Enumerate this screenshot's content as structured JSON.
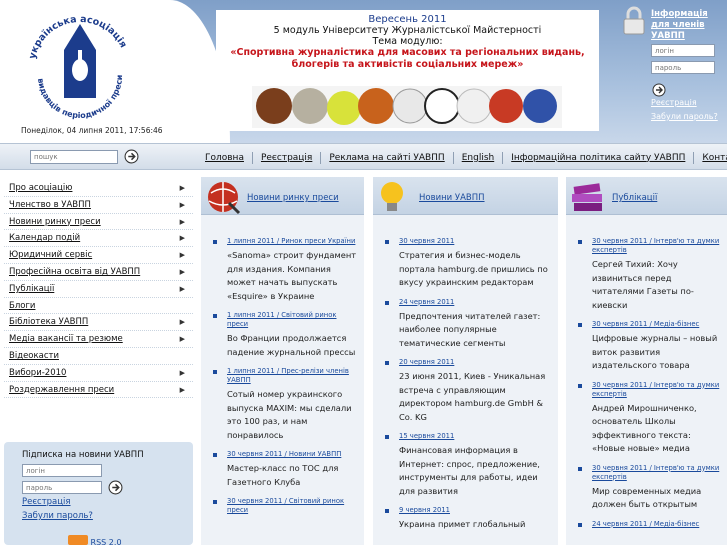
{
  "header": {
    "date": "Понеділок, 04 липня 2011, 17:56:46",
    "logo_text_top": "українська асоціація",
    "logo_text_bottom": "видавців періодичної преси",
    "banner": {
      "line1": "Вересень 2011",
      "line2": "5 модуль Університету Журналістської Майстерності",
      "line3": "Тема модулю:",
      "line4": "«Спортивна журналістика для масових та регіональних видань, блогерів та активістів соціальних мереж»"
    },
    "login": {
      "title": "Інформація для членів УАВПП",
      "login_placeholder": "логін",
      "password_placeholder": "пароль",
      "register": "Реєстрація",
      "forgot": "Забули пароль?"
    }
  },
  "navbar": {
    "search_placeholder": "пошук",
    "links": [
      "Головна",
      "Реєстрація",
      "Реклама на сайті УАВПП",
      "English",
      "Інформаційна політика сайту УАВПП",
      "Контакти"
    ]
  },
  "sidebar": {
    "menu": [
      {
        "label": "Про асоціацію",
        "arrow": true
      },
      {
        "label": "Членство в УАВПП",
        "arrow": true
      },
      {
        "label": "Новини ринку преси",
        "arrow": true
      },
      {
        "label": "Календар подій",
        "arrow": true
      },
      {
        "label": "Юридичний сервіс",
        "arrow": true
      },
      {
        "label": "Професійна освіта від УАВПП",
        "arrow": true
      },
      {
        "label": "Публікації",
        "arrow": true
      },
      {
        "label": "Блоги",
        "arrow": false
      },
      {
        "label": "Бібліотека УАВПП",
        "arrow": true
      },
      {
        "label": "Медіа вакансії та резюме",
        "arrow": true
      },
      {
        "label": "Відеокасти",
        "arrow": false
      },
      {
        "label": "Вибори-2010",
        "arrow": true
      },
      {
        "label": "Роздержавлення преси",
        "arrow": true
      }
    ],
    "subscribe": {
      "title": "Підписка на новини УАВПП",
      "login_placeholder": "логін",
      "password_placeholder": "пароль",
      "register": "Реєстрація",
      "forgot": "Забули пароль?",
      "rss": "RSS 2.0"
    }
  },
  "columns": [
    {
      "title": "Новини ринку преси",
      "icon": "globe-icon",
      "items": [
        {
          "meta": "1 липня 2011 / Ринок преси України",
          "text": "«Sanoma» строит фундамент для издания. Компания может начать выпускать «Esquire» в Украине"
        },
        {
          "meta": "1 липня 2011 / Світовий ринок преси",
          "text": "Во Франции продолжается падение журнальной прессы"
        },
        {
          "meta": "1 липня 2011 / Прес-релізи членів УАВПП",
          "text": "Сотый номер украинского выпуска MAXIM: мы сделали это 100 раз, и нам понравилось"
        },
        {
          "meta": "30 червня 2011 / Новини УАВПП",
          "text": "Мастер-класс по ТОС для Газетного Клуба"
        },
        {
          "meta": "30 червня 2011 / Світовий ринок преси",
          "text": ""
        }
      ]
    },
    {
      "title": "Новини УАВПП",
      "icon": "lightbulb-icon",
      "items": [
        {
          "meta": "30 червня 2011",
          "text": "Стратегия и бизнес-модель портала hamburg.de пришлись по вкусу украинским редакторам"
        },
        {
          "meta": "24 червня 2011",
          "text": "Предпочтения читателей газет: наиболее популярные тематические сегменты"
        },
        {
          "meta": "20 червня 2011",
          "text": "23 июня 2011, Киев - Уникальная встреча с управляющим директором hamburg.de GmbH & Co. KG"
        },
        {
          "meta": "15 червня 2011",
          "text": "Финансовая информация в Интернет: спрос, предложение, инструменты для работы, идеи для развития"
        },
        {
          "meta": "9 червня 2011",
          "text": "Украина примет глобальный"
        }
      ]
    },
    {
      "title": "Публікації",
      "icon": "books-icon",
      "items": [
        {
          "meta": "30 червня 2011 / Інтерв'ю та думки експертів",
          "text": "Сергей Тихий: Хочу извиниться перед читателями Газеты по-киевски"
        },
        {
          "meta": "30 червня 2011 / Медіа-бізнес",
          "text": "Цифровые журналы – новый виток развития издательского товара"
        },
        {
          "meta": "30 червня 2011 / Інтерв'ю та думки експертів",
          "text": "Андрей Мирошниченко, основатель Школы эффективного текста: «Новые новые» медиа"
        },
        {
          "meta": "30 червня 2011 / Інтерв'ю та думки експертів",
          "text": "Мир современных медиа должен быть открытым"
        },
        {
          "meta": "24 червня 2011 / Медіа-бізнес",
          "text": ""
        }
      ]
    }
  ],
  "colors": {
    "brand_blue": "#1a4a9c",
    "banner_red": "#c6151b",
    "header_bg": "#a9c1de"
  }
}
